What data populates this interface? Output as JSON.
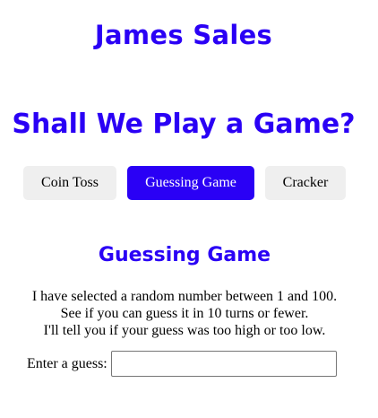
{
  "colors": {
    "accent": "#2a00f5",
    "tab_inactive_bg": "#efefef",
    "tab_active_text": "#ffffff",
    "tab_inactive_text": "#000000"
  },
  "header": {
    "site_title": "James Sales",
    "game_title": "Shall We Play a Game?"
  },
  "tabs": [
    {
      "label": "Coin Toss",
      "active": false
    },
    {
      "label": "Guessing Game",
      "active": true
    },
    {
      "label": "Cracker",
      "active": false
    }
  ],
  "section": {
    "title": "Guessing Game",
    "instructions": [
      "I have selected a random number between 1 and 100.",
      "See if you can guess it in 10 turns or fewer.",
      "I'll tell you if your guess was too high or too low."
    ]
  },
  "guess": {
    "label": "Enter a guess:",
    "value": "",
    "placeholder": ""
  }
}
